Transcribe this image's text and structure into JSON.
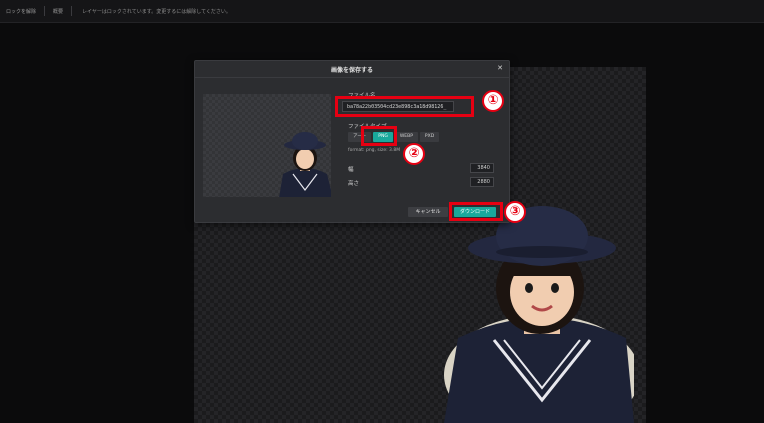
{
  "topbar": {
    "unlock_label": "ロックを解除",
    "detail_label": "概要",
    "message": "レイヤーはロックされています。変更するには解除してください。"
  },
  "dialog": {
    "title": "画像を保存する",
    "close_icon": "close-icon",
    "filename_label": "ファイル名",
    "filename_value": "ba78a22b03504cd23e898c3a18d98126_",
    "filetype_label": "ファイルタイプ",
    "file_types": [
      "アート",
      "PNG",
      "WEBP",
      "PXD"
    ],
    "selected_type": "PNG",
    "format_info": "format: png, size: 3.8M",
    "width_label": "幅",
    "width_value": "3840",
    "height_label": "高さ",
    "height_value": "2880",
    "cancel_label": "キャンセル",
    "download_label": "ダウンロード"
  },
  "annotations": [
    "①",
    "②",
    "③"
  ],
  "colors": {
    "accent": "#19a89c",
    "highlight": "#e60012"
  }
}
